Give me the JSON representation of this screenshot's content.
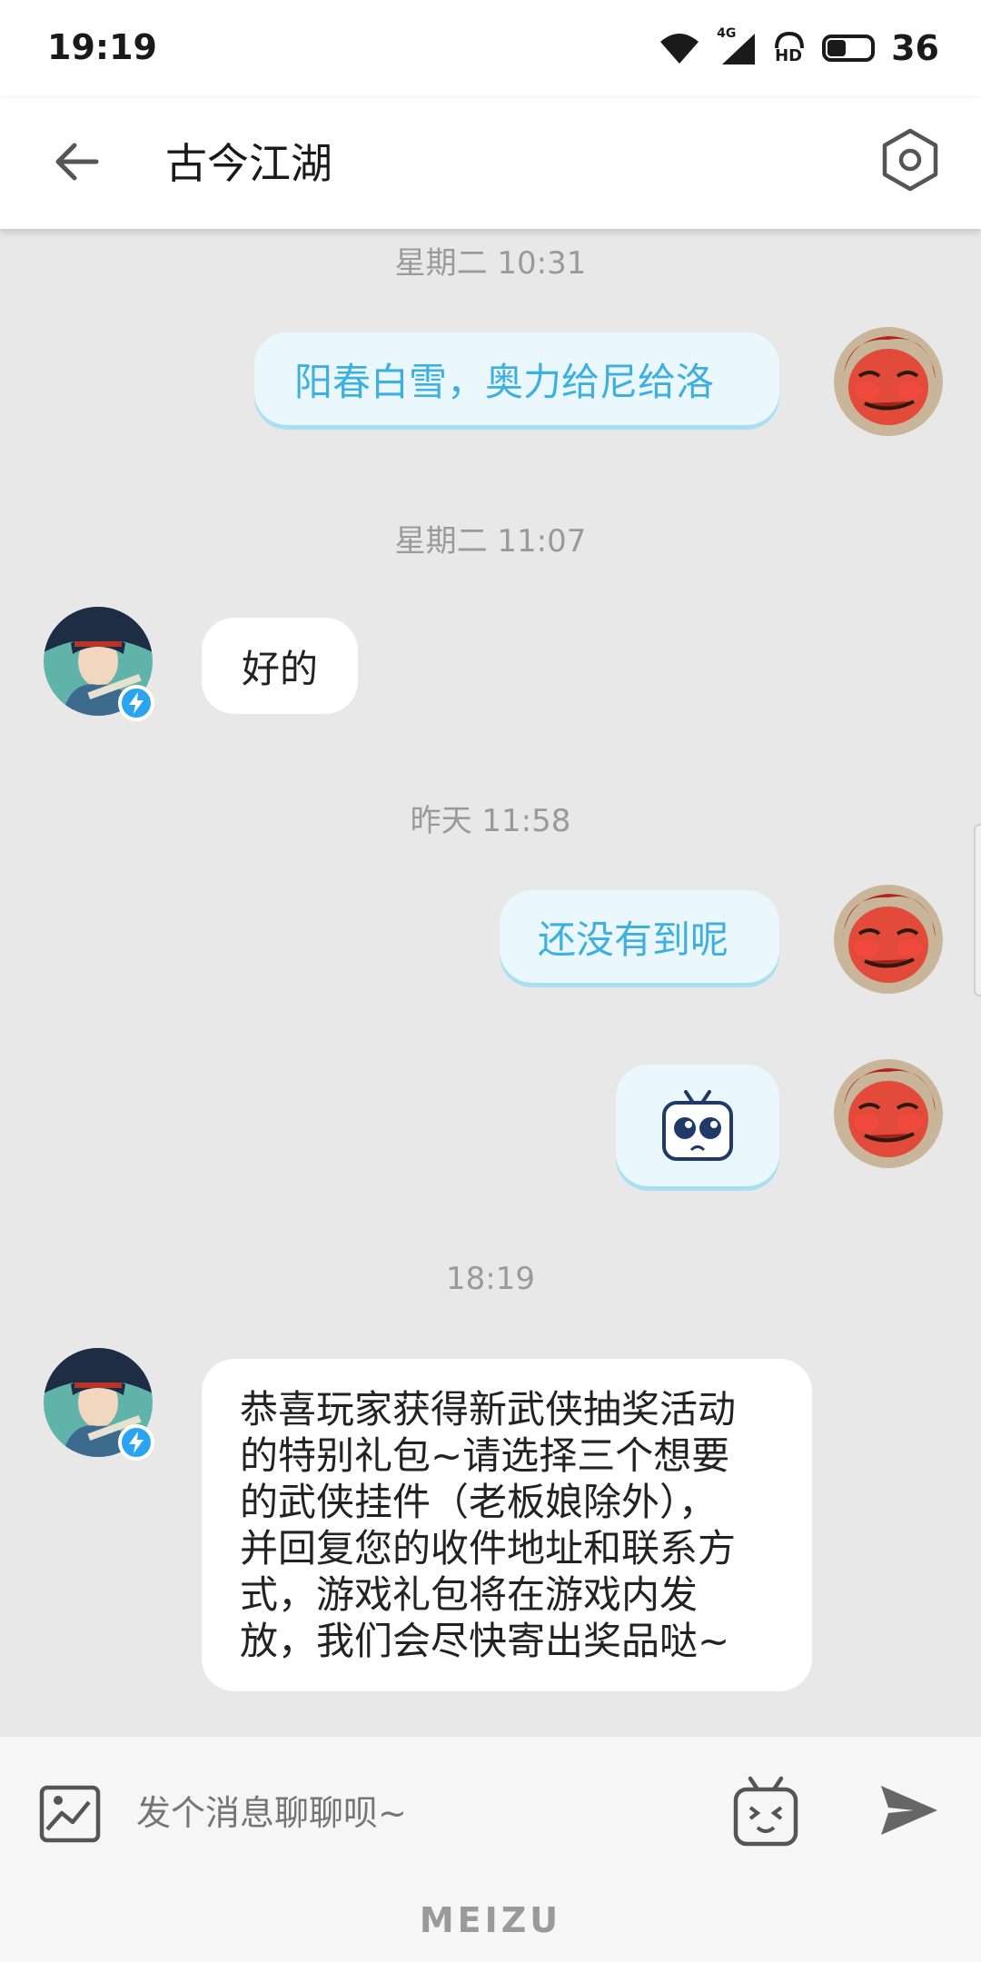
{
  "status_bar": {
    "time": "19:19",
    "network": "4G",
    "hd_label": "HD",
    "battery": "36"
  },
  "header": {
    "title": "古今江湖"
  },
  "messages": [
    {
      "stamp": "星期二 10:31",
      "side": "out",
      "text": "阳春白雪，奥力给尼给洛"
    },
    {
      "stamp": "星期二 11:07",
      "side": "in",
      "text": "好的"
    },
    {
      "stamp": "昨天 11:58",
      "side": "out",
      "text": "还没有到呢"
    },
    {
      "side": "out",
      "type": "sticker",
      "sticker": "sad-tv-mascot"
    },
    {
      "stamp": "18:19",
      "side": "in",
      "lines": [
        "恭喜玩家获得新武侠抽奖活动",
        "的特别礼包~请选择三个想要",
        "的武侠挂件（老板娘除外），",
        "并回复您的收件地址和联系方",
        "式，游戏礼包将在游戏内发",
        "放，我们会尽快寄出奖品哒~"
      ]
    }
  ],
  "input": {
    "placeholder": "发个消息聊聊呗~"
  },
  "brand": "MEIZU",
  "colors": {
    "outgoing_text": "#3dafe0",
    "outgoing_bubble": "#eaf8fd",
    "badge": "#2aa4f0"
  }
}
